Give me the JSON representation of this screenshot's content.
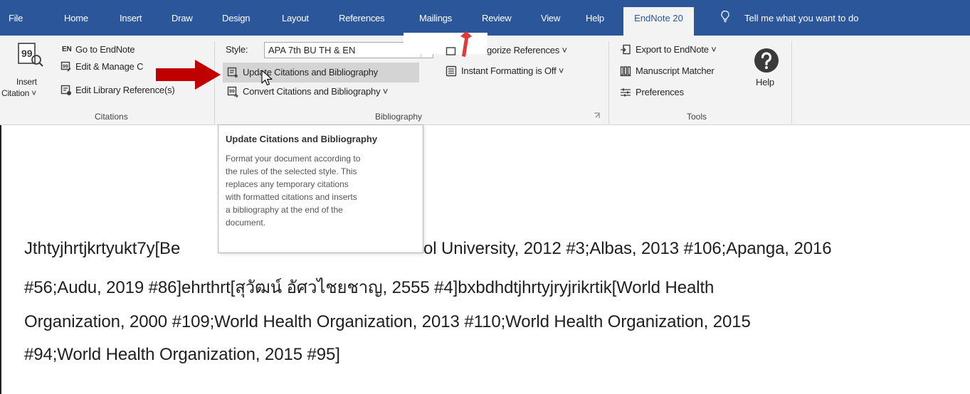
{
  "tabs": [
    {
      "id": "file",
      "label": "File"
    },
    {
      "id": "home",
      "label": "Home"
    },
    {
      "id": "insert",
      "label": "Insert"
    },
    {
      "id": "draw",
      "label": "Draw"
    },
    {
      "id": "design",
      "label": "Design"
    },
    {
      "id": "layout",
      "label": "Layout"
    },
    {
      "id": "references",
      "label": "References"
    },
    {
      "id": "mailings",
      "label": "Mailings"
    },
    {
      "id": "review",
      "label": "Review"
    },
    {
      "id": "view",
      "label": "View"
    },
    {
      "id": "help",
      "label": "Help"
    },
    {
      "id": "endnote",
      "label": "EndNote 20"
    }
  ],
  "tell_me": "Tell me what you want to do",
  "citations_group": {
    "insert_line1": "Insert",
    "insert_line2": "Citation ˅",
    "go_to": "Go to EndNote",
    "en_badge": "EN",
    "edit_manage": "Edit & Manage C",
    "edit_library": "Edit Library Reference(s)",
    "label": "Citations"
  },
  "bibliography_group": {
    "style_label": "Style:",
    "style_value": "APA 7th BU TH & EN",
    "categorize": "gorize References ˅",
    "update": "Update Citations and Bibliography",
    "convert": "Convert Citations and Bibliography ˅",
    "instant": "Instant Formatting is Off ˅",
    "label": "Bibliography"
  },
  "tools_group": {
    "export": "Export to EndNote ˅",
    "manuscript": "Manuscript Matcher",
    "preferences": "Preferences",
    "help": "Help",
    "label": "Tools"
  },
  "tooltip": {
    "title": "Update Citations and Bibliography",
    "lines": [
      "Format your document according to",
      "the rules of the selected style. This",
      "replaces any temporary citations",
      "with formatted citations and inserts",
      "a bibliography at the end of the",
      "document."
    ]
  },
  "document": {
    "line1_a": "Jthtyjhrtjkrtyukt7y[Be",
    "line1_b": "ol University, 2012 #3;Albas, 2013 #106;Apanga, 2016",
    "line2": "#56;Audu, 2019 #86]ehrthrt[สุวัฒน์ อัศวไชยชาญ, 2555 #4]bxbdhdtjhrtyjryjrikrtik[World Health",
    "line3": "Organization, 2000 #109;World Health Organization, 2013 #110;World Health Organization, 2015",
    "line4": "#94;World Health Organization, 2015 #95]"
  },
  "colors": {
    "ribbon_tab_bg": "#2b579a",
    "ribbon_bg": "#f3f3f3",
    "highlight": "#d4d4d4",
    "arrow": "#c00000"
  }
}
